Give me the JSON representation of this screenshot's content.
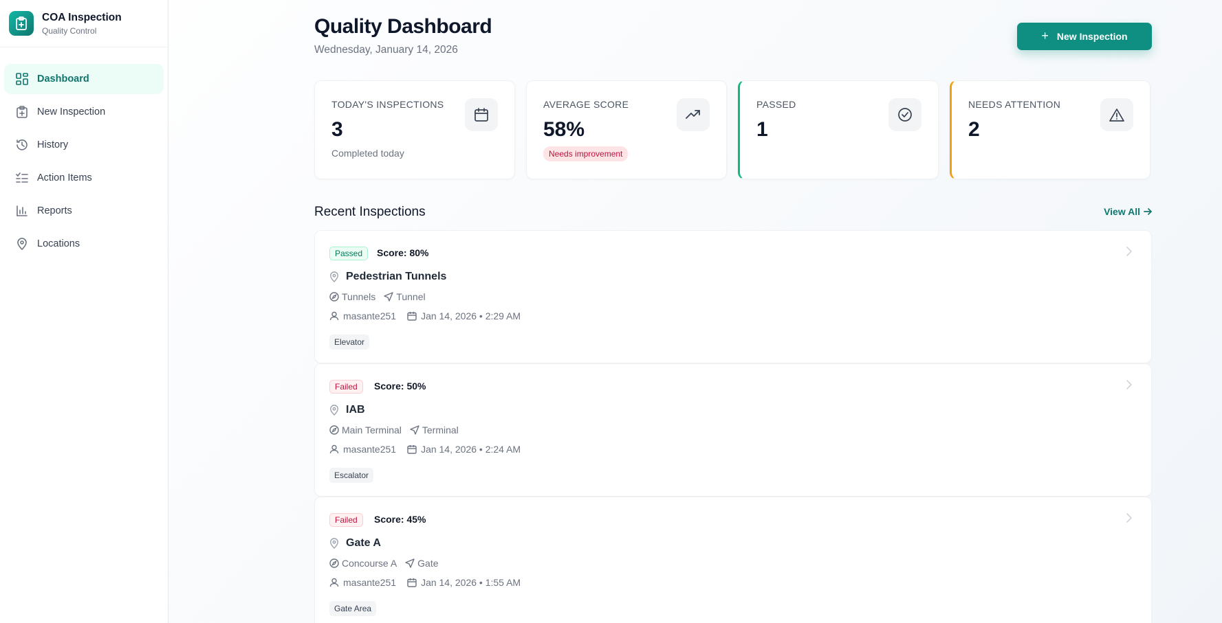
{
  "app": {
    "title": "COA Inspection",
    "subtitle": "Quality Control"
  },
  "sidebar": {
    "items": [
      {
        "label": "Dashboard",
        "icon": "dashboard-icon",
        "active": true
      },
      {
        "label": "New Inspection",
        "icon": "clipboard-plus-icon"
      },
      {
        "label": "History",
        "icon": "history-icon"
      },
      {
        "label": "Action Items",
        "icon": "list-checks-icon"
      },
      {
        "label": "Reports",
        "icon": "bar-chart-icon"
      },
      {
        "label": "Locations",
        "icon": "map-pin-icon"
      }
    ]
  },
  "header": {
    "title": "Quality Dashboard",
    "date": "Wednesday, January 14, 2026",
    "new_button": "New Inspection"
  },
  "stats": [
    {
      "label": "TODAY'S INSPECTIONS",
      "value": "3",
      "sub": "Completed today",
      "icon": "calendar-icon"
    },
    {
      "label": "AVERAGE SCORE",
      "value": "58%",
      "badge": "Needs improvement",
      "icon": "trending-up-icon"
    },
    {
      "label": "PASSED",
      "value": "1",
      "icon": "check-circle-icon",
      "accent": "#10b981"
    },
    {
      "label": "NEEDS ATTENTION",
      "value": "2",
      "icon": "alert-triangle-icon",
      "accent": "#f59e0b"
    }
  ],
  "recent": {
    "title": "Recent Inspections",
    "view_all": "View All",
    "items": [
      {
        "status": "Passed",
        "score": "Score: 80%",
        "location": "Pedestrian Tunnels",
        "area": "Tunnels",
        "type": "Tunnel",
        "user": "masante251",
        "datetime": "Jan 14, 2026 • 2:29 AM",
        "tag": "Elevator"
      },
      {
        "status": "Failed",
        "score": "Score: 50%",
        "location": "IAB",
        "area": "Main Terminal",
        "type": "Terminal",
        "user": "masante251",
        "datetime": "Jan 14, 2026 • 2:24 AM",
        "tag": "Escalator"
      },
      {
        "status": "Failed",
        "score": "Score: 45%",
        "location": "Gate A",
        "area": "Concourse A",
        "type": "Gate",
        "user": "masante251",
        "datetime": "Jan 14, 2026 • 1:55 AM",
        "tag": "Gate Area"
      }
    ]
  },
  "colors": {
    "brand": "#0f8f82",
    "passed": "#10b981",
    "attention": "#f59e0b",
    "failed": "#be123c"
  }
}
